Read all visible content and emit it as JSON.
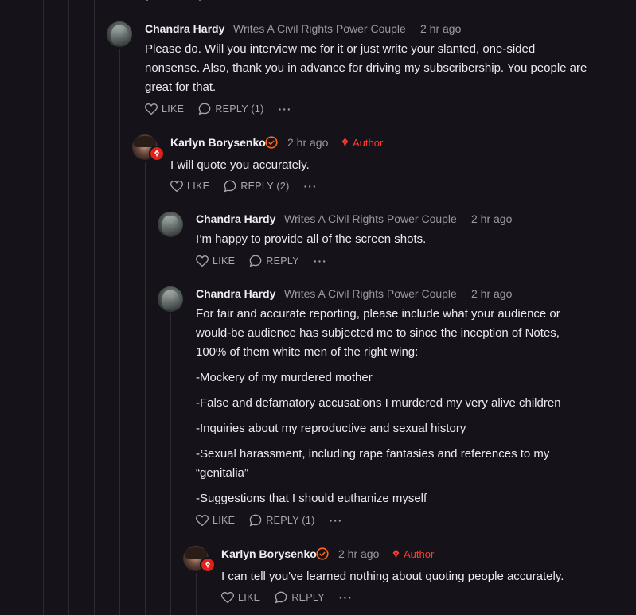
{
  "comments": [
    {
      "name": "Chandra Hardy",
      "subtitle": "Writes A Civil Rights Power Couple",
      "time": "2 hr ago",
      "body": [
        "Please do. Will you interview me for it or just write your slanted, one-sided nonsense. Also, thank you in advance for driving my subscribership. You people are great for that."
      ],
      "like": "LIKE",
      "reply": "REPLY (1)"
    },
    {
      "name": "Karlyn Borysenko",
      "time": "2 hr ago",
      "author_label": "Author",
      "body": [
        "I will quote you accurately."
      ],
      "like": "LIKE",
      "reply": "REPLY (2)"
    },
    {
      "name": "Chandra Hardy",
      "subtitle": "Writes A Civil Rights Power Couple",
      "time": "2 hr ago",
      "body": [
        "I’m happy to provide all of the screen shots."
      ],
      "like": "LIKE",
      "reply": "REPLY"
    },
    {
      "name": "Chandra Hardy",
      "subtitle": "Writes A Civil Rights Power Couple",
      "time": "2 hr ago",
      "body": [
        "For fair and accurate reporting, please include what your audience or would-be audience has subjected me to since the inception of Notes, 100% of them white men of the right wing:",
        "-Mockery of my murdered mother",
        "-False and defamatory accusations I murdered my very alive children",
        "-Inquiries about my reproductive and sexual history",
        "-Sexual harassment, including rape fantasies and references to my “genitalia”",
        "-Suggestions that I should euthanize myself"
      ],
      "like": "LIKE",
      "reply": "REPLY (1)"
    },
    {
      "name": "Karlyn Borysenko",
      "time": "2 hr ago",
      "author_label": "Author",
      "body": [
        "I can tell you've learned nothing about quoting people accurately."
      ],
      "like": "LIKE",
      "reply": "REPLY"
    }
  ],
  "more_label": "···",
  "icons": {
    "like": "heart-icon",
    "reply": "comment-bubble-icon",
    "verified": "verified-check-icon",
    "author": "quill-pen-icon",
    "more": "more-options-icon"
  },
  "colors": {
    "background": "#15121a",
    "author_red": "#ff3b30",
    "verified_orange": "#ff6719"
  }
}
